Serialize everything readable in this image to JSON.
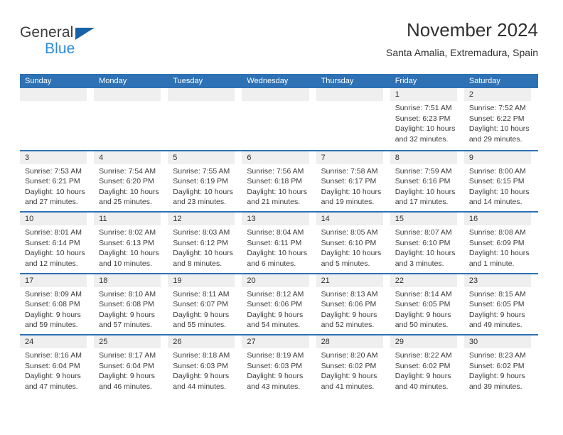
{
  "brand": {
    "name_top": "General",
    "name_bottom": "Blue",
    "triangle_color": "#1663a8",
    "blue_color": "#2a8bd5"
  },
  "header": {
    "title": "November 2024",
    "subtitle": "Santa Amalia, Extremadura, Spain"
  },
  "theme": {
    "accent": "#2e72b5",
    "day_band": "#efefef",
    "text": "#3b3b3b"
  },
  "calendar": {
    "day_headers": [
      "Sunday",
      "Monday",
      "Tuesday",
      "Wednesday",
      "Thursday",
      "Friday",
      "Saturday"
    ],
    "weeks": [
      [
        {
          "day": "",
          "lines": []
        },
        {
          "day": "",
          "lines": []
        },
        {
          "day": "",
          "lines": []
        },
        {
          "day": "",
          "lines": []
        },
        {
          "day": "",
          "lines": []
        },
        {
          "day": "1",
          "lines": [
            "Sunrise: 7:51 AM",
            "Sunset: 6:23 PM",
            "Daylight: 10 hours",
            "and 32 minutes."
          ]
        },
        {
          "day": "2",
          "lines": [
            "Sunrise: 7:52 AM",
            "Sunset: 6:22 PM",
            "Daylight: 10 hours",
            "and 29 minutes."
          ]
        }
      ],
      [
        {
          "day": "3",
          "lines": [
            "Sunrise: 7:53 AM",
            "Sunset: 6:21 PM",
            "Daylight: 10 hours",
            "and 27 minutes."
          ]
        },
        {
          "day": "4",
          "lines": [
            "Sunrise: 7:54 AM",
            "Sunset: 6:20 PM",
            "Daylight: 10 hours",
            "and 25 minutes."
          ]
        },
        {
          "day": "5",
          "lines": [
            "Sunrise: 7:55 AM",
            "Sunset: 6:19 PM",
            "Daylight: 10 hours",
            "and 23 minutes."
          ]
        },
        {
          "day": "6",
          "lines": [
            "Sunrise: 7:56 AM",
            "Sunset: 6:18 PM",
            "Daylight: 10 hours",
            "and 21 minutes."
          ]
        },
        {
          "day": "7",
          "lines": [
            "Sunrise: 7:58 AM",
            "Sunset: 6:17 PM",
            "Daylight: 10 hours",
            "and 19 minutes."
          ]
        },
        {
          "day": "8",
          "lines": [
            "Sunrise: 7:59 AM",
            "Sunset: 6:16 PM",
            "Daylight: 10 hours",
            "and 17 minutes."
          ]
        },
        {
          "day": "9",
          "lines": [
            "Sunrise: 8:00 AM",
            "Sunset: 6:15 PM",
            "Daylight: 10 hours",
            "and 14 minutes."
          ]
        }
      ],
      [
        {
          "day": "10",
          "lines": [
            "Sunrise: 8:01 AM",
            "Sunset: 6:14 PM",
            "Daylight: 10 hours",
            "and 12 minutes."
          ]
        },
        {
          "day": "11",
          "lines": [
            "Sunrise: 8:02 AM",
            "Sunset: 6:13 PM",
            "Daylight: 10 hours",
            "and 10 minutes."
          ]
        },
        {
          "day": "12",
          "lines": [
            "Sunrise: 8:03 AM",
            "Sunset: 6:12 PM",
            "Daylight: 10 hours",
            "and 8 minutes."
          ]
        },
        {
          "day": "13",
          "lines": [
            "Sunrise: 8:04 AM",
            "Sunset: 6:11 PM",
            "Daylight: 10 hours",
            "and 6 minutes."
          ]
        },
        {
          "day": "14",
          "lines": [
            "Sunrise: 8:05 AM",
            "Sunset: 6:10 PM",
            "Daylight: 10 hours",
            "and 5 minutes."
          ]
        },
        {
          "day": "15",
          "lines": [
            "Sunrise: 8:07 AM",
            "Sunset: 6:10 PM",
            "Daylight: 10 hours",
            "and 3 minutes."
          ]
        },
        {
          "day": "16",
          "lines": [
            "Sunrise: 8:08 AM",
            "Sunset: 6:09 PM",
            "Daylight: 10 hours",
            "and 1 minute."
          ]
        }
      ],
      [
        {
          "day": "17",
          "lines": [
            "Sunrise: 8:09 AM",
            "Sunset: 6:08 PM",
            "Daylight: 9 hours",
            "and 59 minutes."
          ]
        },
        {
          "day": "18",
          "lines": [
            "Sunrise: 8:10 AM",
            "Sunset: 6:08 PM",
            "Daylight: 9 hours",
            "and 57 minutes."
          ]
        },
        {
          "day": "19",
          "lines": [
            "Sunrise: 8:11 AM",
            "Sunset: 6:07 PM",
            "Daylight: 9 hours",
            "and 55 minutes."
          ]
        },
        {
          "day": "20",
          "lines": [
            "Sunrise: 8:12 AM",
            "Sunset: 6:06 PM",
            "Daylight: 9 hours",
            "and 54 minutes."
          ]
        },
        {
          "day": "21",
          "lines": [
            "Sunrise: 8:13 AM",
            "Sunset: 6:06 PM",
            "Daylight: 9 hours",
            "and 52 minutes."
          ]
        },
        {
          "day": "22",
          "lines": [
            "Sunrise: 8:14 AM",
            "Sunset: 6:05 PM",
            "Daylight: 9 hours",
            "and 50 minutes."
          ]
        },
        {
          "day": "23",
          "lines": [
            "Sunrise: 8:15 AM",
            "Sunset: 6:05 PM",
            "Daylight: 9 hours",
            "and 49 minutes."
          ]
        }
      ],
      [
        {
          "day": "24",
          "lines": [
            "Sunrise: 8:16 AM",
            "Sunset: 6:04 PM",
            "Daylight: 9 hours",
            "and 47 minutes."
          ]
        },
        {
          "day": "25",
          "lines": [
            "Sunrise: 8:17 AM",
            "Sunset: 6:04 PM",
            "Daylight: 9 hours",
            "and 46 minutes."
          ]
        },
        {
          "day": "26",
          "lines": [
            "Sunrise: 8:18 AM",
            "Sunset: 6:03 PM",
            "Daylight: 9 hours",
            "and 44 minutes."
          ]
        },
        {
          "day": "27",
          "lines": [
            "Sunrise: 8:19 AM",
            "Sunset: 6:03 PM",
            "Daylight: 9 hours",
            "and 43 minutes."
          ]
        },
        {
          "day": "28",
          "lines": [
            "Sunrise: 8:20 AM",
            "Sunset: 6:02 PM",
            "Daylight: 9 hours",
            "and 41 minutes."
          ]
        },
        {
          "day": "29",
          "lines": [
            "Sunrise: 8:22 AM",
            "Sunset: 6:02 PM",
            "Daylight: 9 hours",
            "and 40 minutes."
          ]
        },
        {
          "day": "30",
          "lines": [
            "Sunrise: 8:23 AM",
            "Sunset: 6:02 PM",
            "Daylight: 9 hours",
            "and 39 minutes."
          ]
        }
      ]
    ]
  }
}
